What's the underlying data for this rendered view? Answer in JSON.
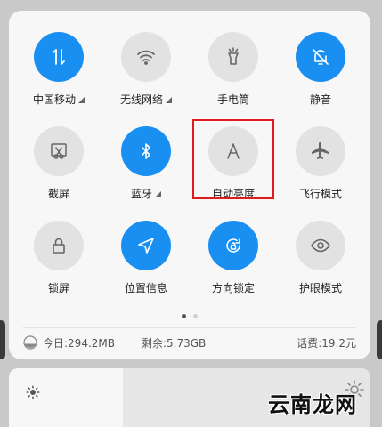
{
  "tiles": [
    {
      "label": "中国移动",
      "state": "on",
      "icon": "mobile-data-icon",
      "dropdown": true
    },
    {
      "label": "无线网络",
      "state": "off",
      "icon": "wifi-icon",
      "dropdown": true
    },
    {
      "label": "手电筒",
      "state": "off",
      "icon": "flashlight-icon",
      "dropdown": false
    },
    {
      "label": "静音",
      "state": "on",
      "icon": "bell-off-icon",
      "dropdown": false
    },
    {
      "label": "截屏",
      "state": "off",
      "icon": "screenshot-icon",
      "dropdown": false
    },
    {
      "label": "蓝牙",
      "state": "on",
      "icon": "bluetooth-icon",
      "dropdown": true
    },
    {
      "label": "自动亮度",
      "state": "off",
      "icon": "auto-brightness-icon",
      "dropdown": false
    },
    {
      "label": "飞行模式",
      "state": "off",
      "icon": "airplane-icon",
      "dropdown": false
    },
    {
      "label": "锁屏",
      "state": "off",
      "icon": "lock-icon",
      "dropdown": false
    },
    {
      "label": "位置信息",
      "state": "on",
      "icon": "location-icon",
      "dropdown": false
    },
    {
      "label": "方向锁定",
      "state": "on",
      "icon": "rotation-lock-icon",
      "dropdown": false
    },
    {
      "label": "护眼模式",
      "state": "off",
      "icon": "eye-icon",
      "dropdown": false
    }
  ],
  "status": {
    "today": "今日:294.2MB",
    "remaining": "剩余:5.73GB",
    "balance": "话费:19.2元"
  },
  "page_dots": {
    "count": 2,
    "active": 0
  },
  "watermark": {
    "text": "云南龙网"
  },
  "colors": {
    "accent": "#1a8ff2",
    "highlight": "#e01b1b",
    "inactive": "#e2e2e2"
  }
}
